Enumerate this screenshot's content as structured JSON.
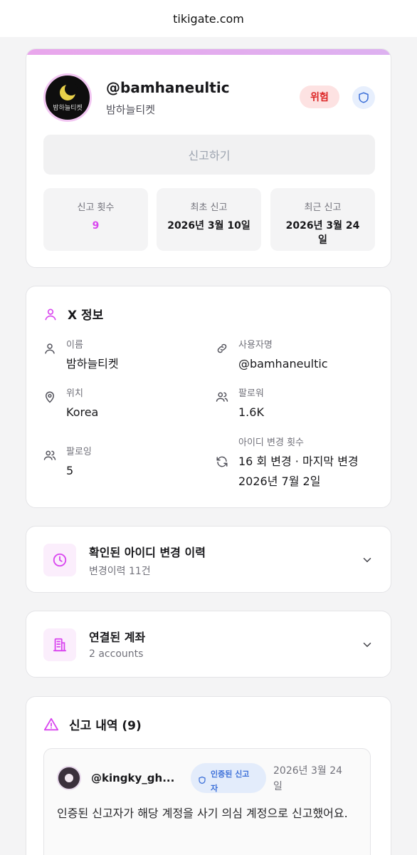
{
  "browser": {
    "url": "tikigate.com"
  },
  "profile": {
    "avatar_text": "밤하늘티켓",
    "handle": "@bamhaneultic",
    "display_name": "밤하늘티켓",
    "risk_badge": "위험",
    "report_button": "신고하기",
    "stats": [
      {
        "label": "신고 횟수",
        "value": "9"
      },
      {
        "label": "최초 신고",
        "value": "2026년 3월 10일"
      },
      {
        "label": "최근 신고",
        "value": "2026년 3월 24일"
      }
    ],
    "colors": {
      "accent": "#d946ef",
      "danger": "#dc2626",
      "shield": "#3b6fd8"
    }
  },
  "x_info": {
    "title": "X 정보",
    "fields": {
      "name": {
        "label": "이름",
        "value": "밤하늘티켓",
        "icon": "user-icon"
      },
      "username": {
        "label": "사용자명",
        "value": "@bamhaneultic",
        "icon": "link-icon"
      },
      "location": {
        "label": "위치",
        "value": "Korea",
        "icon": "location-pin-icon"
      },
      "followers": {
        "label": "팔로워",
        "value": "1.6K",
        "icon": "users-icon"
      },
      "following": {
        "label": "팔로잉",
        "value": "5",
        "icon": "users-icon"
      },
      "id_changes": {
        "label": "아이디 변경 횟수",
        "value_line1": "16 회 변경 · 마지막 변경",
        "value_line2": "2026년 7월 2일",
        "icon": "refresh-icon"
      }
    }
  },
  "id_history": {
    "title": "확인된 아이디 변경 이력",
    "subtitle": "변경이력 11건"
  },
  "linked_accounts": {
    "title": "연결된 계좌",
    "subtitle": "2 accounts"
  },
  "reports": {
    "title": "신고 내역 (9)",
    "items": [
      {
        "handle": "@kingky_gh...",
        "badge_line1": "인증된 신고",
        "badge_line2": "자",
        "date_line1": "2026년 3월 24",
        "date_line2": "일",
        "text": "인증된 신고자가 해당 계정을 사기 의심 계정으로 신고했어요."
      }
    ]
  }
}
